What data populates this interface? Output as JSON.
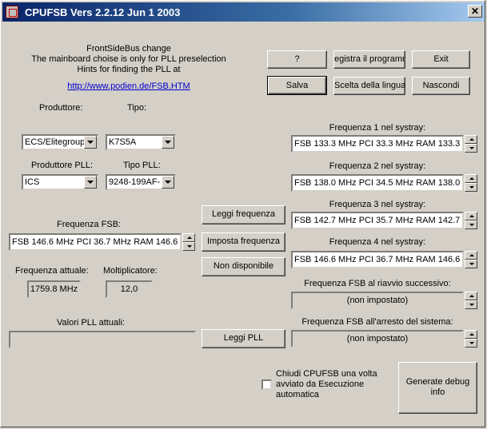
{
  "window": {
    "title": "CPUFSB  Vers 2.2.12  Jun  1 2003",
    "close_label": "✕"
  },
  "intro": {
    "line1": "FrontSideBus change",
    "line2": "The mainboard choise is only for PLL preselection",
    "line3": "Hints for finding the PLL at",
    "link": "http://www.podien.de/FSB.HTM"
  },
  "buttons": {
    "help": "?",
    "register": "egistra il programm",
    "exit": "Exit",
    "save": "Salva",
    "language": "Scelta della lingua",
    "hide": "Nascondi",
    "read_freq": "Leggi frequenza",
    "set_freq": "Imposta frequenza",
    "not_available": "Non disponibile",
    "read_pll": "Leggi PLL",
    "debug_line1": "Generate debug",
    "debug_line2": "info"
  },
  "mainboard": {
    "producer_label": "Produttore:",
    "type_label": "Tipo:",
    "producer_value": "ECS/Elitegroup",
    "type_value": "K7S5A",
    "pll_producer_label": "Produttore PLL:",
    "pll_type_label": "Tipo PLL:",
    "pll_producer_value": "ICS",
    "pll_type_value": "9248-199AF-"
  },
  "fsb": {
    "label": "Frequenza FSB:",
    "value": "FSB 146.6 MHz  PCI 36.7 MHz  RAM 146.6",
    "current_label": "Frequenza attuale:",
    "current_value": "1759.8 MHz",
    "mult_label": "Moltiplicatore:",
    "mult_value": "12,0",
    "pll_values_label": "Valori PLL attuali:",
    "pll_values": ""
  },
  "systray": [
    {
      "label": "Frequenza 1 nel systray:",
      "value": "FSB 133.3 MHz  PCI 33.3 MHz  RAM 133.3"
    },
    {
      "label": "Frequenza 2 nel systray:",
      "value": "FSB 138.0 MHz  PCI 34.5 MHz  RAM 138.0"
    },
    {
      "label": "Frequenza 3 nel systray:",
      "value": "FSB 142.7 MHz  PCI 35.7 MHz  RAM 142.7"
    },
    {
      "label": "Frequenza 4 nel systray:",
      "value": "FSB 146.6 MHz  PCI 36.7 MHz  RAM 146.6"
    }
  ],
  "restart": {
    "label": "Frequenza FSB al riavvio successivo:",
    "value": "(non impostato)"
  },
  "shutdown": {
    "label": "Frequenza FSB all'arresto del sistema:",
    "value": "(non impostato)"
  },
  "close_option": {
    "line1": "Chiudi CPUFSB una volta",
    "line2": "avviato da Esecuzione",
    "line3": "automatica",
    "checked": false
  }
}
